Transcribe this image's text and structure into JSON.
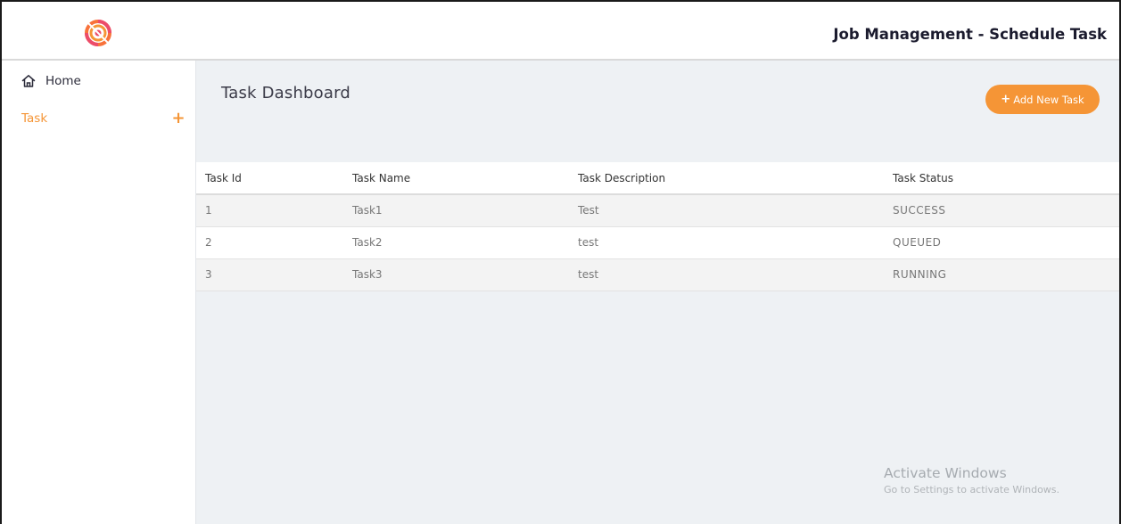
{
  "header": {
    "title": "Job Management - Schedule Task",
    "logo_icon": "target-logo-icon"
  },
  "sidebar": {
    "items": [
      {
        "label": "Home",
        "icon": "home-icon"
      },
      {
        "label": "Task",
        "icon": "plus-icon",
        "active": true
      }
    ]
  },
  "main": {
    "title": "Task Dashboard",
    "add_button_label": "Add New Task",
    "table": {
      "columns": [
        "Task Id",
        "Task Name",
        "Task Description",
        "Task Status"
      ],
      "rows": [
        {
          "id": "1",
          "name": "Task1",
          "description": "Test",
          "status": "SUCCESS"
        },
        {
          "id": "2",
          "name": "Task2",
          "description": "test",
          "status": "QUEUED"
        },
        {
          "id": "3",
          "name": "Task3",
          "description": "test",
          "status": "RUNNING"
        }
      ]
    }
  },
  "watermark": {
    "title": "Activate Windows",
    "subtitle": "Go to Settings to activate Windows."
  },
  "colors": {
    "accent": "#f59536",
    "background": "#eef1f4"
  }
}
